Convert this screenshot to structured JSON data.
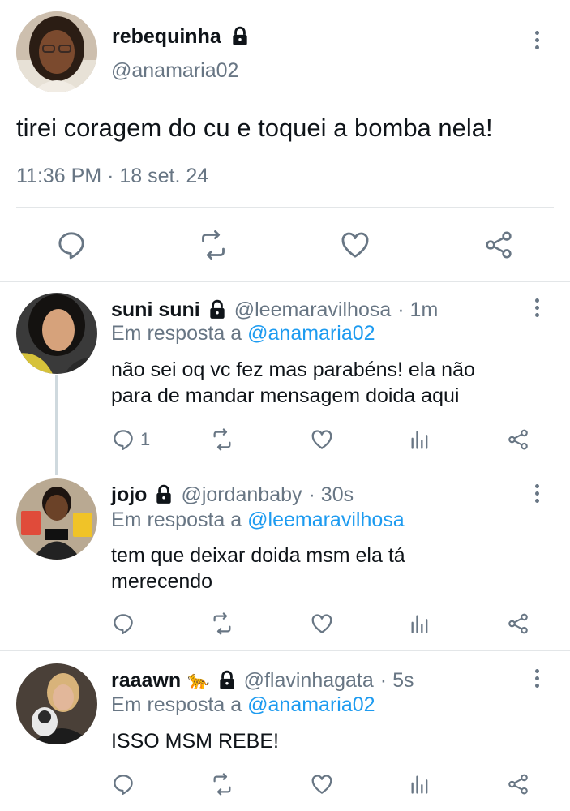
{
  "main_tweet": {
    "display_name": "rebequinha",
    "handle": "@anamaria02",
    "text": "tirei coragem do cu e toquei a bomba nela!",
    "timestamp": "11:36 PM · 18 set. 24",
    "actions": [
      "reply-icon",
      "retweet-icon",
      "like-icon",
      "share-icon"
    ]
  },
  "replies": [
    {
      "display_name": "suni suni",
      "handle": "@leemaravilhosa",
      "time": "· 1m",
      "reply_prefix": "Em resposta a",
      "reply_to": "@anamaria02",
      "text_lines": [
        "não sei oq vc fez mas parabéns! ela não",
        "para de mandar mensagem doida aqui"
      ],
      "reply_count": "1"
    },
    {
      "display_name": "jojo",
      "handle": "@jordanbaby",
      "time": "· 30s",
      "reply_prefix": "Em resposta a",
      "reply_to": "@leemaravilhosa",
      "text_lines": [
        "tem que deixar doida msm ela tá",
        "merecendo"
      ],
      "reply_count": ""
    },
    {
      "display_name": "raaawn",
      "emoji": "🐆",
      "handle": "@flavinhagata",
      "time": "· 5s",
      "reply_prefix": "Em resposta a",
      "reply_to": "@anamaria02",
      "text_lines": [
        "ISSO MSM REBE!"
      ],
      "reply_count": ""
    }
  ],
  "colors": {
    "text": "#0f1419",
    "muted": "#687684",
    "link": "#1d9bf0",
    "divider": "#e3e6e8"
  }
}
